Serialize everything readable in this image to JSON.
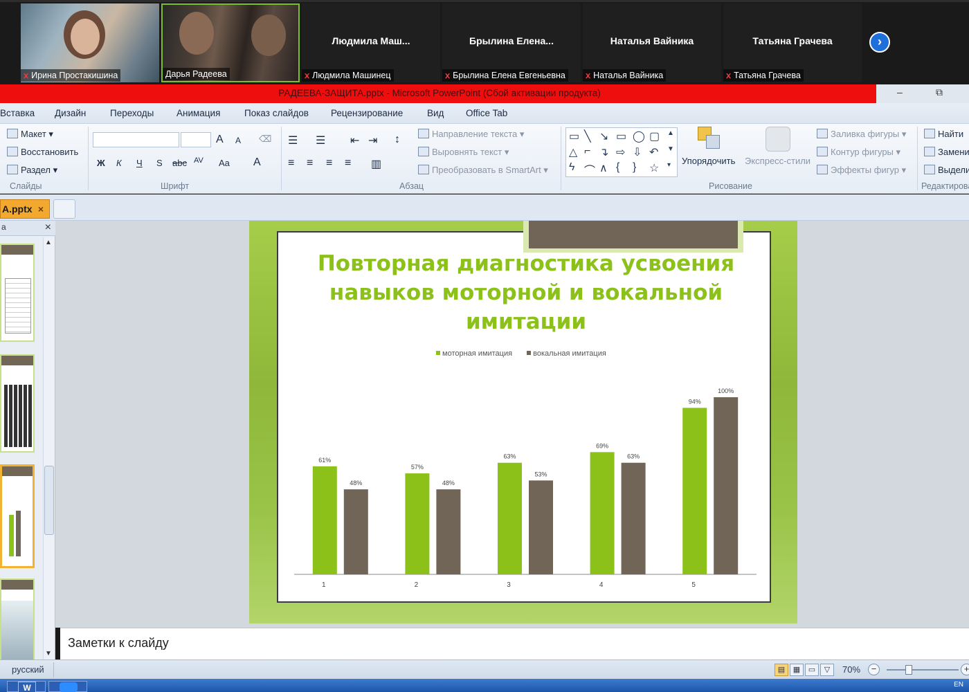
{
  "zoom": {
    "participants": [
      {
        "name": "Ирина Простакишина",
        "label": "Ирина Простакишина",
        "muted": true,
        "video": true
      },
      {
        "name": "Дарья Радеева",
        "label": "Дарья Радеева",
        "muted": false,
        "video": true,
        "active_speaker": true
      },
      {
        "display": "Людмила  Маш...",
        "label": "Людмила Машинец",
        "muted": true,
        "video": false
      },
      {
        "display": "Брылина  Елена...",
        "label": "Брылина Елена Евгеньевна",
        "muted": true,
        "video": false
      },
      {
        "display": "Наталья Вайника",
        "label": "Наталья Вайника",
        "muted": true,
        "video": false
      },
      {
        "display": "Татьяна Грачева",
        "label": "Татьяна Грачева",
        "muted": true,
        "video": false
      }
    ],
    "next_page_icon": "chevron-right-icon",
    "mic_icon": "mic-off-icon"
  },
  "window": {
    "title": "РАДЕЕВА-ЗАЩИТА.pptx  -  Microsoft PowerPoint (Сбой активации продукта)",
    "accent": "#ee0e0e",
    "minimize": "–",
    "restore": "⧉"
  },
  "menu": [
    "Вставка",
    "Дизайн",
    "Переходы",
    "Анимация",
    "Показ слайдов",
    "Рецензирование",
    "Вид",
    "Office Tab"
  ],
  "ribbon": {
    "slides": {
      "layout": "Макет",
      "reset": "Восстановить",
      "section": "Раздел",
      "label": "Слайды"
    },
    "font": {
      "label": "Шрифт",
      "bold": "Ж",
      "italic": "К",
      "underline": "Ч",
      "shadow": "S",
      "strike": "abc",
      "spacing": "AV",
      "case": "Aa",
      "color": "A",
      "grow": "A",
      "shrink": "A"
    },
    "paragraph": {
      "label": "Абзац",
      "direction": "Направление текста",
      "align": "Выровнять текст",
      "smartart": "Преобразовать в SmartArt"
    },
    "drawing": {
      "label": "Рисование",
      "arrange": "Упорядочить",
      "quick_styles": "Экспресс-стили",
      "fill": "Заливка фигуры",
      "outline": "Контур фигуры",
      "effects": "Эффекты фигур"
    },
    "editing": {
      "label": "Редактирование",
      "find": "Найти",
      "replace": "Заменить",
      "select": "Выделить"
    }
  },
  "doc_tab": {
    "name": "А.pptx",
    "close": "×"
  },
  "side_panel": {
    "header": "а",
    "close": "×"
  },
  "slide": {
    "title": "Повторная диагностика усвоения навыков моторной и вокальной имитации"
  },
  "chart_data": {
    "type": "bar",
    "categories": [
      "1",
      "2",
      "3",
      "4",
      "5"
    ],
    "series": [
      {
        "name": "моторная  имитация",
        "values": [
          61,
          57,
          63,
          69,
          94
        ],
        "color": "#8cc11a"
      },
      {
        "name": "вокальная  имитация",
        "values": [
          48,
          48,
          53,
          63,
          100
        ],
        "color": "#716557"
      }
    ],
    "value_suffix": "%",
    "ylim": [
      0,
      100
    ],
    "grid": false,
    "legend": "top"
  },
  "notes": {
    "placeholder": "Заметки к слайду"
  },
  "status": {
    "language": "русский",
    "zoom": "70%",
    "zoom_level": 0.7
  },
  "taskbar": {
    "word": "W",
    "tray": "EN"
  }
}
